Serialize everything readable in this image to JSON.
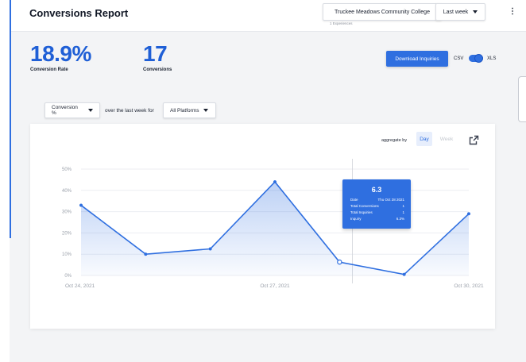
{
  "header": {
    "title": "Conversions Report",
    "college": "Truckee Meadows Community College",
    "college_sub": "1 Experiences",
    "range": "Last week"
  },
  "kpis": {
    "conversion_rate": {
      "value": "18.9%",
      "label": "Conversion Rate"
    },
    "conversions": {
      "value": "17",
      "label": "Conversions"
    }
  },
  "export": {
    "download_label": "Download Inquiries",
    "csv_label": "CSV",
    "xls_label": "XLS",
    "toggle_on": "XLS"
  },
  "filters": {
    "metric": "Conversion %",
    "connector": "over the last week for",
    "platform": "All Platforms"
  },
  "aggregate": {
    "label": "aggregate by",
    "day": "Day",
    "week": "Week",
    "active": "Day"
  },
  "tooltip": {
    "value": "6.3",
    "rows": [
      {
        "k": "Date",
        "v": "Thu Oct 28 2021"
      },
      {
        "k": "Total Conversions",
        "v": "1"
      },
      {
        "k": "Total Inquiries",
        "v": "1"
      },
      {
        "k": "Inquiry",
        "v": "6.3%"
      }
    ]
  },
  "colors": {
    "accent": "#2f6fe0",
    "kpi": "#1f5fd6"
  },
  "chart_data": {
    "type": "area",
    "x": [
      "Oct 24, 2021",
      "Oct 25, 2021",
      "Oct 26, 2021",
      "Oct 27, 2021",
      "Oct 28, 2021",
      "Oct 29, 2021",
      "Oct 30, 2021"
    ],
    "values": [
      33,
      10,
      12.5,
      44,
      6.3,
      0.5,
      29
    ],
    "y_ticks": [
      "0%",
      "10%",
      "20%",
      "30%",
      "40%",
      "50%"
    ],
    "x_ticks": [
      "Oct 24, 2021",
      "Oct 27, 2021",
      "Oct 30, 2021"
    ],
    "ylim": [
      0,
      50
    ],
    "grid": true,
    "highlight_index": 4
  }
}
